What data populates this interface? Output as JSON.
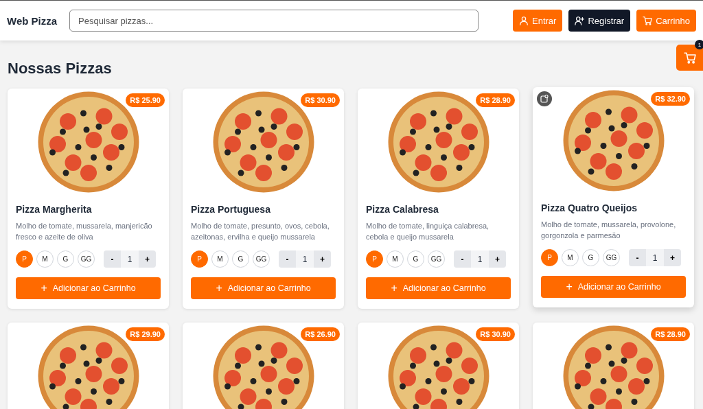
{
  "header": {
    "brand": "Web Pizza",
    "search": {
      "placeholder": "Pesquisar pizzas..."
    },
    "buttons": [
      {
        "label": "Entrar",
        "kind": "login"
      },
      {
        "label": "Registrar",
        "kind": "register"
      },
      {
        "label": "Carrinho",
        "kind": "cart"
      }
    ]
  },
  "floating_cart": {
    "badge": "1"
  },
  "heading": "Nossas Pizzas",
  "pizzas": [
    {
      "name": "Pizza Margherita",
      "price": "R$ 25.90",
      "description": "Molho de tomate, mussarela, manjericão fresco e azeite de oliva",
      "hovered": false,
      "sizes": [
        {
          "label": "P",
          "selected": true
        },
        {
          "label": "M",
          "selected": false
        },
        {
          "label": "G",
          "selected": false
        },
        {
          "label": "GG",
          "selected": false
        }
      ],
      "stepper": {
        "minus": "-",
        "quantity": "1",
        "plus": "+"
      },
      "add_button": {
        "icon": "+",
        "label": "Adicionar ao Carrinho"
      }
    },
    {
      "name": "Pizza Portuguesa",
      "price": "R$ 30.90",
      "description": "Molho de tomate, presunto, ovos, cebola, azeitonas, ervilha e queijo mussarela",
      "hovered": false,
      "sizes": [
        {
          "label": "P",
          "selected": true
        },
        {
          "label": "M",
          "selected": false
        },
        {
          "label": "G",
          "selected": false
        },
        {
          "label": "GG",
          "selected": false
        }
      ],
      "stepper": {
        "minus": "-",
        "quantity": "1",
        "plus": "+"
      },
      "add_button": {
        "icon": "+",
        "label": "Adicionar ao Carrinho"
      }
    },
    {
      "name": "Pizza Calabresa",
      "price": "R$ 28.90",
      "description": "Molho de tomate, linguiça calabresa, cebola e queijo mussarela",
      "hovered": false,
      "sizes": [
        {
          "label": "P",
          "selected": true
        },
        {
          "label": "M",
          "selected": false
        },
        {
          "label": "G",
          "selected": false
        },
        {
          "label": "GG",
          "selected": false
        }
      ],
      "stepper": {
        "minus": "-",
        "quantity": "1",
        "plus": "+"
      },
      "add_button": {
        "icon": "+",
        "label": "Adicionar ao Carrinho"
      }
    },
    {
      "name": "Pizza Quatro Queijos",
      "price": "R$ 32.90",
      "description": "Molho de tomate, mussarela, provolone, gorgonzola e parmesão",
      "hovered": true,
      "sizes": [
        {
          "label": "P",
          "selected": true
        },
        {
          "label": "M",
          "selected": false
        },
        {
          "label": "G",
          "selected": false
        },
        {
          "label": "GG",
          "selected": false
        }
      ],
      "stepper": {
        "minus": "-",
        "quantity": "1",
        "plus": "+"
      },
      "add_button": {
        "icon": "+",
        "label": "Adicionar ao Carrinho"
      }
    },
    {
      "price": "R$ 29.90",
      "hovered": false
    },
    {
      "price": "R$ 26.90",
      "hovered": false
    },
    {
      "price": "R$ 30.90",
      "hovered": false
    },
    {
      "price": "R$ 28.90",
      "hovered": false
    }
  ]
}
